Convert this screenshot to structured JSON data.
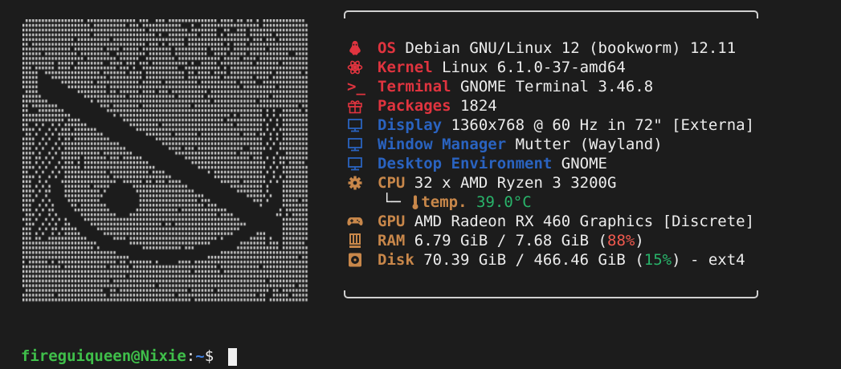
{
  "colors": {
    "background": "#1c1c1c",
    "red": "#e0343f",
    "blue": "#2a63c0",
    "orange": "#c8874a",
    "green": "#29b36a"
  },
  "fetch": {
    "os": {
      "icon": "penguin-icon",
      "label": "OS",
      "value": "Debian GNU/Linux 12 (bookworm) 12.11"
    },
    "kernel": {
      "icon": "atom-icon",
      "label": "Kernel",
      "value": "Linux 6.1.0-37-amd64"
    },
    "terminal": {
      "icon": "terminal-prompt-icon",
      "glyph": ">_",
      "label": "Terminal",
      "value": "GNOME Terminal 3.46.8"
    },
    "packages": {
      "icon": "gift-box-icon",
      "label": "Packages",
      "value": "1824"
    },
    "display": {
      "icon": "monitor-icon",
      "label": "Display",
      "value": "1360x768 @ 60 Hz in 72\" [Externa]"
    },
    "wm": {
      "icon": "monitor-icon",
      "label": "Window Manager",
      "value": "Mutter (Wayland)"
    },
    "de": {
      "icon": "monitor-icon",
      "label": "Desktop Environment",
      "value": "GNOME"
    },
    "cpu": {
      "icon": "gear-icon",
      "label": "CPU",
      "value": "32 x AMD Ryzen 3 3200G"
    },
    "temp": {
      "tree": "└─",
      "icon": "thermometer-icon",
      "label": "temp.",
      "value": "39.0°C"
    },
    "gpu": {
      "icon": "gamepad-icon",
      "label": "GPU",
      "value": "AMD Radeon RX 460 Graphics [Discrete]"
    },
    "ram": {
      "icon": "memory-chip-icon",
      "label": "RAM",
      "value": "6.79 GiB / 7.68 GiB (",
      "percent": "88%",
      "suffix": ")"
    },
    "disk": {
      "icon": "disk-icon",
      "label": "Disk",
      "value": "70.39 GiB / 466.46 GiB (",
      "percent": "15%",
      "suffix": ") - ext4"
    }
  },
  "prompt": {
    "user_host": "fireguiqueen@Nixie",
    "sep": ":",
    "path": "~",
    "symbol": "$ "
  }
}
